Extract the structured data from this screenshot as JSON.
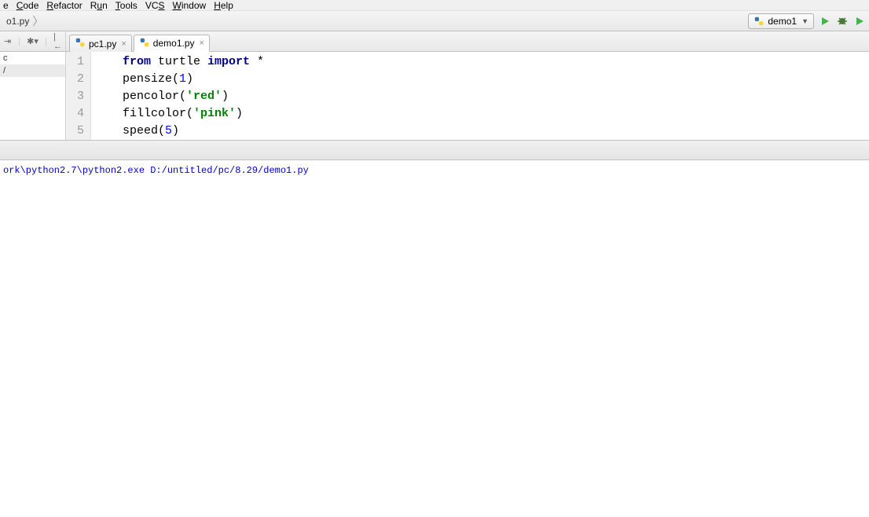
{
  "menu": {
    "items": [
      "e",
      "Code",
      "Refactor",
      "Run",
      "Tools",
      "VCS",
      "Window",
      "Help"
    ],
    "underlines": [
      "",
      "C",
      "R",
      "u",
      "T",
      "S",
      "W",
      "H"
    ]
  },
  "breadcrumb": {
    "file": "o1.py"
  },
  "run": {
    "config": "demo1"
  },
  "tabs": [
    {
      "name": "pc1.py",
      "active": false
    },
    {
      "name": "demo1.py",
      "active": true
    }
  ],
  "sidebar": {
    "items": [
      "c",
      "/"
    ]
  },
  "code": {
    "lines": [
      {
        "n": 1,
        "tokens": [
          [
            "kw",
            "from"
          ],
          [
            "",
            " turtle "
          ],
          [
            "kw",
            "import"
          ],
          [
            "",
            " *"
          ]
        ]
      },
      {
        "n": 2,
        "tokens": [
          [
            "",
            "pensize("
          ],
          [
            "num",
            "1"
          ],
          [
            "",
            ")"
          ]
        ]
      },
      {
        "n": 3,
        "tokens": [
          [
            "",
            "pencolor("
          ],
          [
            "str",
            "'red'"
          ],
          [
            "",
            ")"
          ]
        ]
      },
      {
        "n": 4,
        "tokens": [
          [
            "",
            "fillcolor("
          ],
          [
            "str",
            "'pink'"
          ],
          [
            "",
            ")"
          ]
        ]
      },
      {
        "n": 5,
        "tokens": [
          [
            "",
            "speed("
          ],
          [
            "num",
            "5"
          ],
          [
            "",
            ")"
          ]
        ]
      }
    ]
  },
  "console": {
    "line": "ork\\python2.7\\python2.exe D:/untitled/pc/8.29/demo1.py"
  }
}
